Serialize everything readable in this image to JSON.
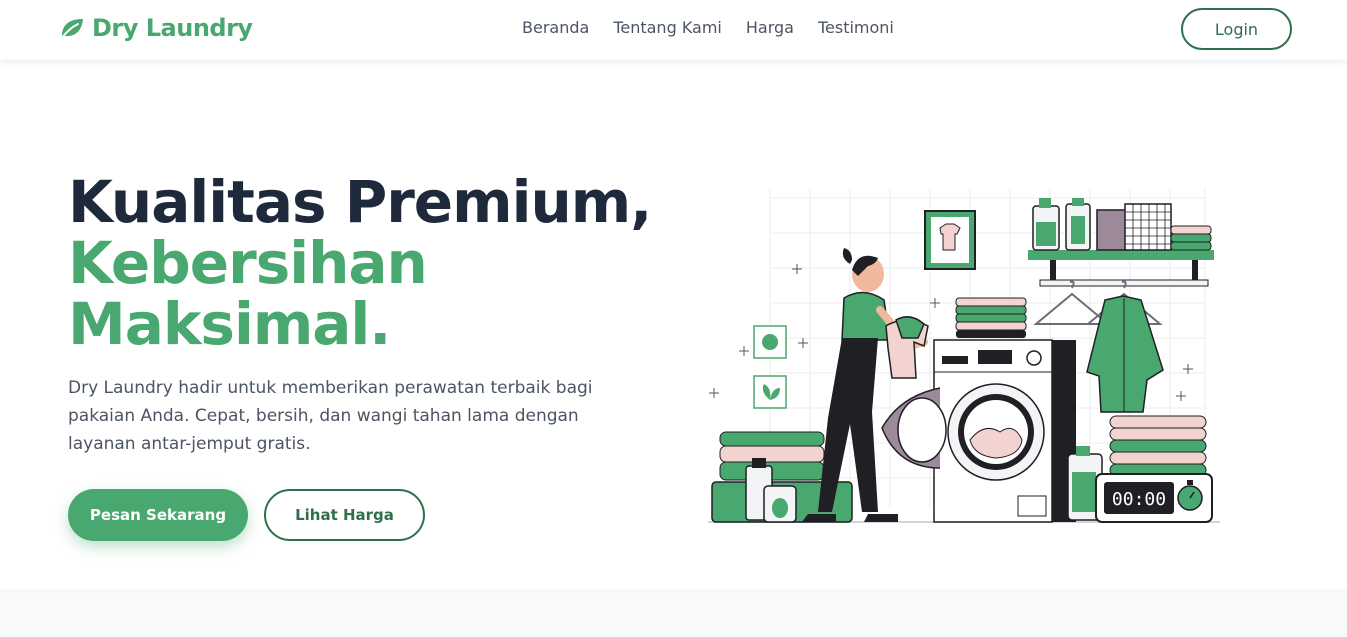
{
  "brand": {
    "name": "Dry Laundry",
    "icon": "leaf-icon",
    "color": "#48a86f"
  },
  "nav": {
    "links": [
      {
        "label": "Beranda"
      },
      {
        "label": "Tentang Kami"
      },
      {
        "label": "Harga"
      },
      {
        "label": "Testimoni"
      }
    ],
    "login_label": "Login"
  },
  "hero": {
    "title_line1": "Kualitas Premium,",
    "title_line2": "Kebersihan",
    "title_line3": "Maksimal.",
    "description": "Dry Laundry hadir untuk memberikan perawatan terbaik bagi pakaian Anda. Cepat, bersih, dan wangi tahan lama dengan layanan antar-jemput gratis.",
    "primary_cta": "Pesan Sekarang",
    "secondary_cta": "Lihat Harga"
  },
  "illustration": {
    "timer_display": "00:00"
  },
  "colors": {
    "accent": "#48a86f",
    "accent_dark": "#2f6f4a",
    "heading": "#1e293b",
    "text": "#4b5563",
    "pink": "#f2d3d0",
    "dark": "#1f1f24"
  }
}
